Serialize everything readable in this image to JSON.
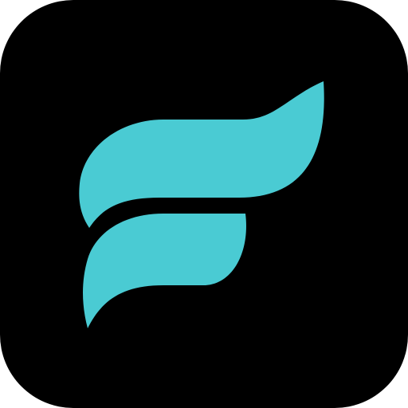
{
  "icon": {
    "semantic": "app-icon-flowing-f",
    "colors": {
      "background": "#000000",
      "mark": "#4ACBD3",
      "page": "#ffffff"
    }
  }
}
